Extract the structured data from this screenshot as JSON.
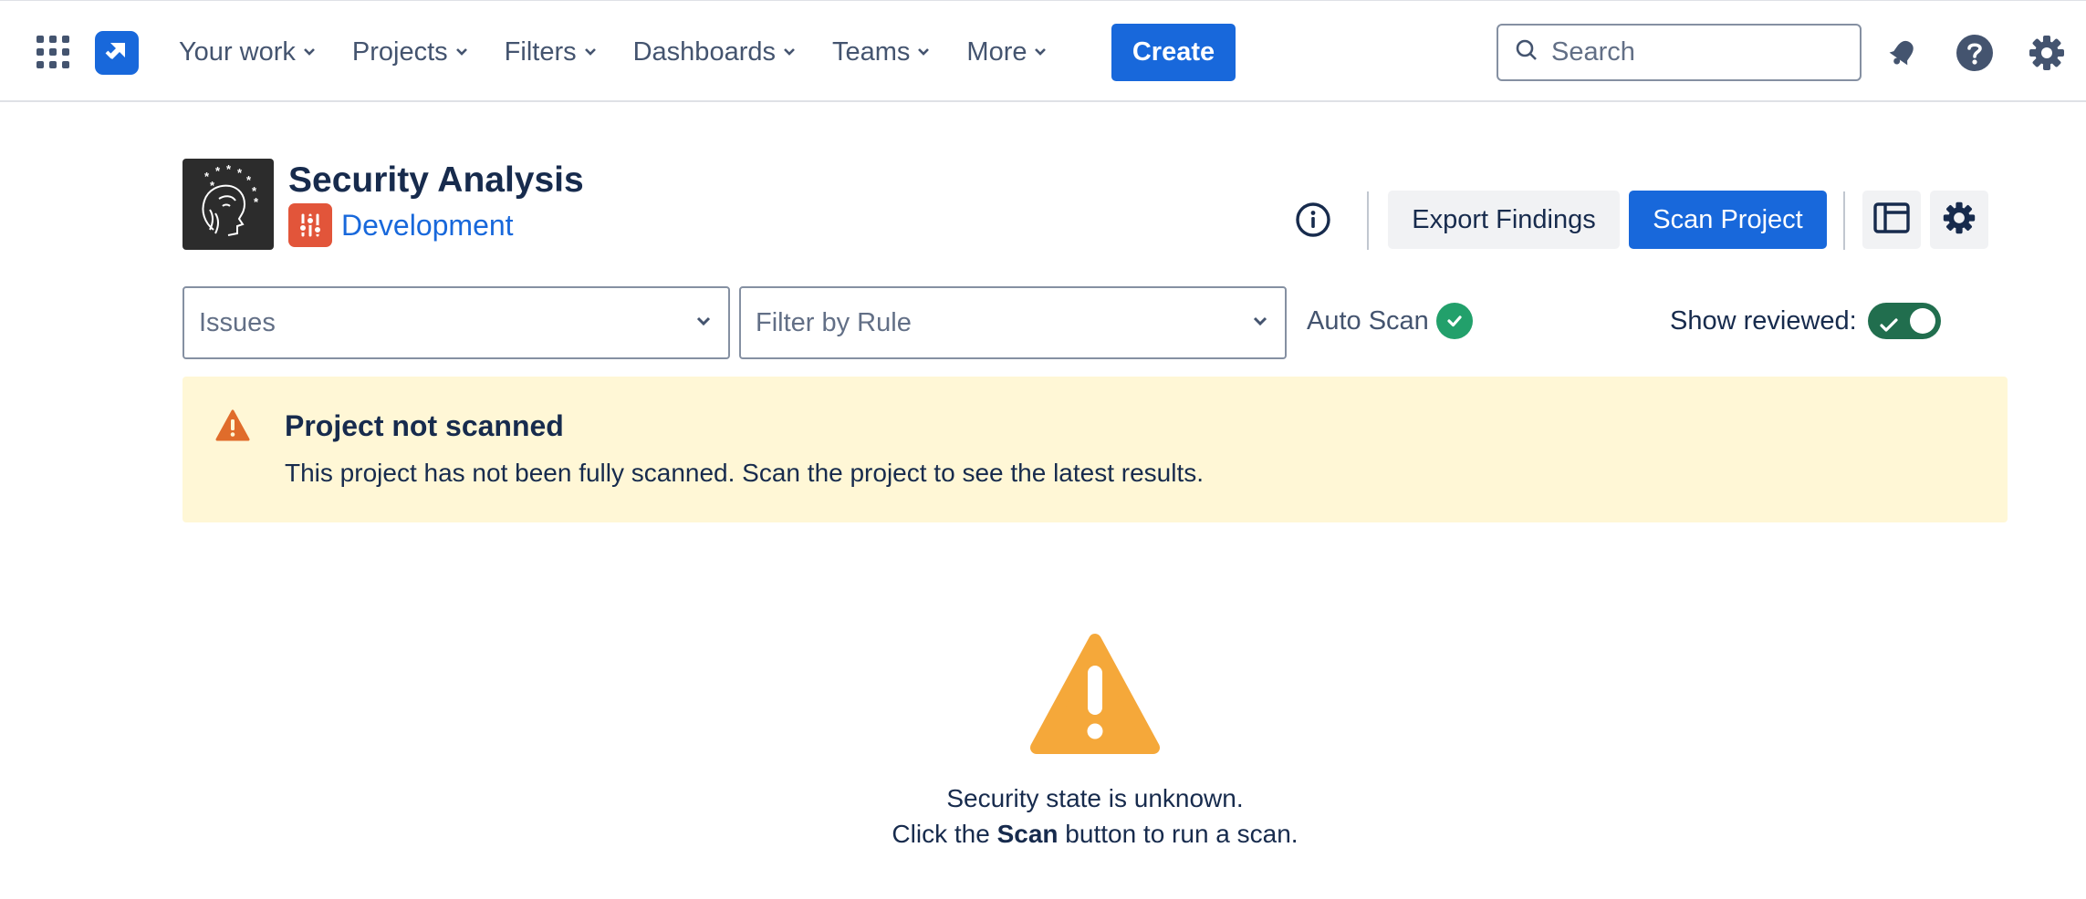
{
  "nav": {
    "items": [
      {
        "label": "Your work"
      },
      {
        "label": "Projects"
      },
      {
        "label": "Filters"
      },
      {
        "label": "Dashboards"
      },
      {
        "label": "Teams"
      },
      {
        "label": "More"
      }
    ],
    "create_label": "Create",
    "search_placeholder": "Search",
    "icons": [
      "app-switcher-icon",
      "jira-logo",
      "notifications-icon",
      "help-icon",
      "settings-icon"
    ]
  },
  "header": {
    "title": "Security Analysis",
    "space_label": "Development",
    "export_label": "Export Findings",
    "scan_label": "Scan Project"
  },
  "filters": {
    "issues_placeholder": "Issues",
    "rule_placeholder": "Filter by Rule",
    "auto_scan_label": "Auto Scan",
    "show_reviewed_label": "Show reviewed:",
    "show_reviewed_on": true
  },
  "banner": {
    "title": "Project not scanned",
    "text": "This project has not been fully scanned. Scan the project to see the latest results."
  },
  "empty_state": {
    "line1": "Security state is unknown.",
    "line2_prefix": "Click the ",
    "line2_bold": "Scan",
    "line2_suffix": " button to run a scan."
  },
  "colors": {
    "primary": "#1868db",
    "warning_bg": "#fff7d6",
    "warning_icon_banner": "#e06c2b",
    "warning_icon_empty": "#f5a83a",
    "success": "#22a06b",
    "toggle_on": "#216e4e",
    "project_badge": "#e2553a"
  }
}
